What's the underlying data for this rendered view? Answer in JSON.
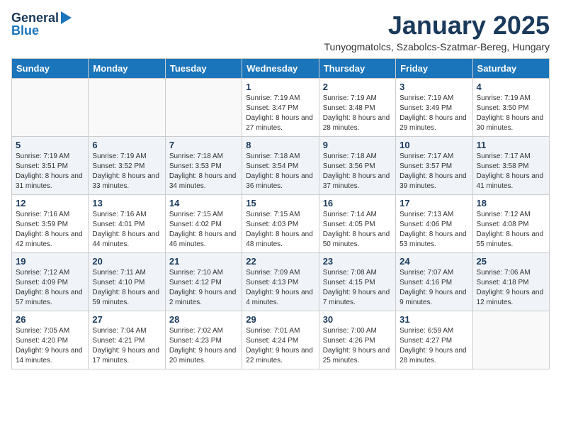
{
  "header": {
    "logo_line1": "General",
    "logo_line2": "Blue",
    "month_title": "January 2025",
    "location": "Tunyogmatolcs, Szabolcs-Szatmar-Bereg, Hungary"
  },
  "weekdays": [
    "Sunday",
    "Monday",
    "Tuesday",
    "Wednesday",
    "Thursday",
    "Friday",
    "Saturday"
  ],
  "weeks": [
    [
      {
        "day": "",
        "info": ""
      },
      {
        "day": "",
        "info": ""
      },
      {
        "day": "",
        "info": ""
      },
      {
        "day": "1",
        "info": "Sunrise: 7:19 AM\nSunset: 3:47 PM\nDaylight: 8 hours and 27 minutes."
      },
      {
        "day": "2",
        "info": "Sunrise: 7:19 AM\nSunset: 3:48 PM\nDaylight: 8 hours and 28 minutes."
      },
      {
        "day": "3",
        "info": "Sunrise: 7:19 AM\nSunset: 3:49 PM\nDaylight: 8 hours and 29 minutes."
      },
      {
        "day": "4",
        "info": "Sunrise: 7:19 AM\nSunset: 3:50 PM\nDaylight: 8 hours and 30 minutes."
      }
    ],
    [
      {
        "day": "5",
        "info": "Sunrise: 7:19 AM\nSunset: 3:51 PM\nDaylight: 8 hours and 31 minutes."
      },
      {
        "day": "6",
        "info": "Sunrise: 7:19 AM\nSunset: 3:52 PM\nDaylight: 8 hours and 33 minutes."
      },
      {
        "day": "7",
        "info": "Sunrise: 7:18 AM\nSunset: 3:53 PM\nDaylight: 8 hours and 34 minutes."
      },
      {
        "day": "8",
        "info": "Sunrise: 7:18 AM\nSunset: 3:54 PM\nDaylight: 8 hours and 36 minutes."
      },
      {
        "day": "9",
        "info": "Sunrise: 7:18 AM\nSunset: 3:56 PM\nDaylight: 8 hours and 37 minutes."
      },
      {
        "day": "10",
        "info": "Sunrise: 7:17 AM\nSunset: 3:57 PM\nDaylight: 8 hours and 39 minutes."
      },
      {
        "day": "11",
        "info": "Sunrise: 7:17 AM\nSunset: 3:58 PM\nDaylight: 8 hours and 41 minutes."
      }
    ],
    [
      {
        "day": "12",
        "info": "Sunrise: 7:16 AM\nSunset: 3:59 PM\nDaylight: 8 hours and 42 minutes."
      },
      {
        "day": "13",
        "info": "Sunrise: 7:16 AM\nSunset: 4:01 PM\nDaylight: 8 hours and 44 minutes."
      },
      {
        "day": "14",
        "info": "Sunrise: 7:15 AM\nSunset: 4:02 PM\nDaylight: 8 hours and 46 minutes."
      },
      {
        "day": "15",
        "info": "Sunrise: 7:15 AM\nSunset: 4:03 PM\nDaylight: 8 hours and 48 minutes."
      },
      {
        "day": "16",
        "info": "Sunrise: 7:14 AM\nSunset: 4:05 PM\nDaylight: 8 hours and 50 minutes."
      },
      {
        "day": "17",
        "info": "Sunrise: 7:13 AM\nSunset: 4:06 PM\nDaylight: 8 hours and 53 minutes."
      },
      {
        "day": "18",
        "info": "Sunrise: 7:12 AM\nSunset: 4:08 PM\nDaylight: 8 hours and 55 minutes."
      }
    ],
    [
      {
        "day": "19",
        "info": "Sunrise: 7:12 AM\nSunset: 4:09 PM\nDaylight: 8 hours and 57 minutes."
      },
      {
        "day": "20",
        "info": "Sunrise: 7:11 AM\nSunset: 4:10 PM\nDaylight: 8 hours and 59 minutes."
      },
      {
        "day": "21",
        "info": "Sunrise: 7:10 AM\nSunset: 4:12 PM\nDaylight: 9 hours and 2 minutes."
      },
      {
        "day": "22",
        "info": "Sunrise: 7:09 AM\nSunset: 4:13 PM\nDaylight: 9 hours and 4 minutes."
      },
      {
        "day": "23",
        "info": "Sunrise: 7:08 AM\nSunset: 4:15 PM\nDaylight: 9 hours and 7 minutes."
      },
      {
        "day": "24",
        "info": "Sunrise: 7:07 AM\nSunset: 4:16 PM\nDaylight: 9 hours and 9 minutes."
      },
      {
        "day": "25",
        "info": "Sunrise: 7:06 AM\nSunset: 4:18 PM\nDaylight: 9 hours and 12 minutes."
      }
    ],
    [
      {
        "day": "26",
        "info": "Sunrise: 7:05 AM\nSunset: 4:20 PM\nDaylight: 9 hours and 14 minutes."
      },
      {
        "day": "27",
        "info": "Sunrise: 7:04 AM\nSunset: 4:21 PM\nDaylight: 9 hours and 17 minutes."
      },
      {
        "day": "28",
        "info": "Sunrise: 7:02 AM\nSunset: 4:23 PM\nDaylight: 9 hours and 20 minutes."
      },
      {
        "day": "29",
        "info": "Sunrise: 7:01 AM\nSunset: 4:24 PM\nDaylight: 9 hours and 22 minutes."
      },
      {
        "day": "30",
        "info": "Sunrise: 7:00 AM\nSunset: 4:26 PM\nDaylight: 9 hours and 25 minutes."
      },
      {
        "day": "31",
        "info": "Sunrise: 6:59 AM\nSunset: 4:27 PM\nDaylight: 9 hours and 28 minutes."
      },
      {
        "day": "",
        "info": ""
      }
    ]
  ]
}
